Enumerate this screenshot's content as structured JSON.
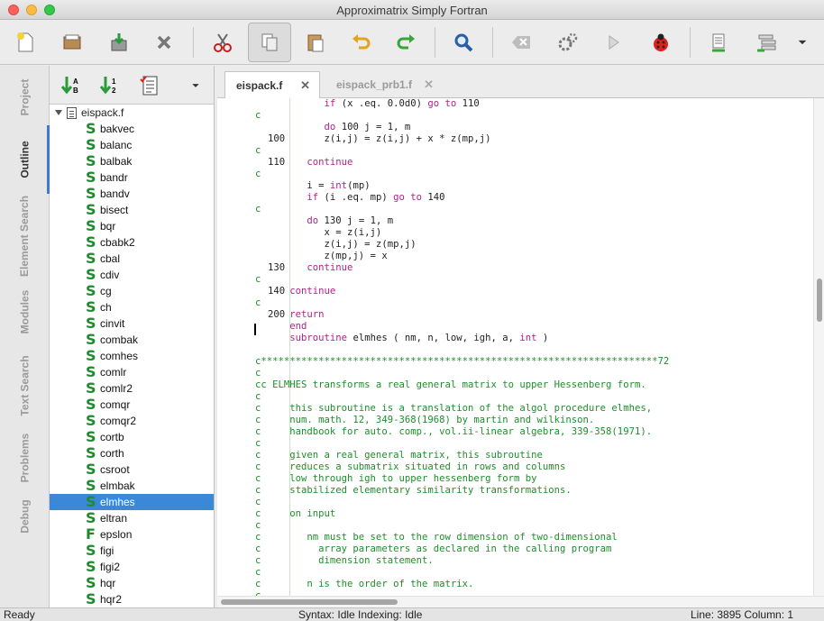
{
  "window": {
    "title": "Approximatrix Simply Fortran"
  },
  "toolbar": {
    "buttons": [
      "new-file",
      "open-folder",
      "save",
      "close",
      "cut",
      "copy",
      "paste",
      "undo",
      "redo",
      "find",
      "clear",
      "build",
      "run",
      "debug",
      "bookmark",
      "project-build",
      "more"
    ]
  },
  "side_tabs": [
    "Project",
    "Outline",
    "Element Search",
    "Modules",
    "Text Search",
    "Problems",
    "Debug"
  ],
  "outline": {
    "root": "eispack.f",
    "items": [
      {
        "kind": "S",
        "name": "bakvec"
      },
      {
        "kind": "S",
        "name": "balanc"
      },
      {
        "kind": "S",
        "name": "balbak"
      },
      {
        "kind": "S",
        "name": "bandr"
      },
      {
        "kind": "S",
        "name": "bandv"
      },
      {
        "kind": "S",
        "name": "bisect"
      },
      {
        "kind": "S",
        "name": "bqr"
      },
      {
        "kind": "S",
        "name": "cbabk2"
      },
      {
        "kind": "S",
        "name": "cbal"
      },
      {
        "kind": "S",
        "name": "cdiv"
      },
      {
        "kind": "S",
        "name": "cg"
      },
      {
        "kind": "S",
        "name": "ch"
      },
      {
        "kind": "S",
        "name": "cinvit"
      },
      {
        "kind": "S",
        "name": "combak"
      },
      {
        "kind": "S",
        "name": "comhes"
      },
      {
        "kind": "S",
        "name": "comlr"
      },
      {
        "kind": "S",
        "name": "comlr2"
      },
      {
        "kind": "S",
        "name": "comqr"
      },
      {
        "kind": "S",
        "name": "comqr2"
      },
      {
        "kind": "S",
        "name": "cortb"
      },
      {
        "kind": "S",
        "name": "corth"
      },
      {
        "kind": "S",
        "name": "csroot"
      },
      {
        "kind": "S",
        "name": "elmbak"
      },
      {
        "kind": "S",
        "name": "elmhes",
        "selected": true
      },
      {
        "kind": "S",
        "name": "eltran"
      },
      {
        "kind": "F",
        "name": "epslon"
      },
      {
        "kind": "S",
        "name": "figi"
      },
      {
        "kind": "S",
        "name": "figi2"
      },
      {
        "kind": "S",
        "name": "hqr"
      },
      {
        "kind": "S",
        "name": "hqr2"
      }
    ]
  },
  "editor": {
    "tabs": [
      {
        "label": "eispack.f",
        "active": true
      },
      {
        "label": "eispack_prb1.f",
        "active": false
      }
    ],
    "lines": [
      {
        "label": "",
        "segs": [
          [
            "id",
            "            "
          ],
          [
            "kw",
            "if"
          ],
          [
            "id",
            " (x .eq. 0.0d0) "
          ],
          [
            "kw",
            "go to"
          ],
          [
            "id",
            " 110"
          ]
        ]
      },
      {
        "label": "",
        "segs": [
          [
            "cm",
            "c"
          ]
        ]
      },
      {
        "label": "",
        "segs": [
          [
            "id",
            "            "
          ],
          [
            "kw",
            "do"
          ],
          [
            "id",
            " 100 j = 1, m"
          ]
        ]
      },
      {
        "label": "100",
        "segs": [
          [
            "id",
            "            z(i,j) = z(i,j) + x * z(mp,j)"
          ]
        ]
      },
      {
        "label": "",
        "segs": [
          [
            "cm",
            "c"
          ]
        ]
      },
      {
        "label": "110",
        "segs": [
          [
            "id",
            "         "
          ],
          [
            "kw",
            "continue"
          ]
        ]
      },
      {
        "label": "",
        "segs": [
          [
            "cm",
            "c"
          ]
        ]
      },
      {
        "label": "",
        "segs": [
          [
            "id",
            "         i = "
          ],
          [
            "kw",
            "int"
          ],
          [
            "id",
            "(mp)"
          ]
        ]
      },
      {
        "label": "",
        "segs": [
          [
            "id",
            "         "
          ],
          [
            "kw",
            "if"
          ],
          [
            "id",
            " (i .eq. mp) "
          ],
          [
            "kw",
            "go to"
          ],
          [
            "id",
            " 140"
          ]
        ]
      },
      {
        "label": "",
        "segs": [
          [
            "cm",
            "c"
          ]
        ]
      },
      {
        "label": "",
        "segs": [
          [
            "id",
            "         "
          ],
          [
            "kw",
            "do"
          ],
          [
            "id",
            " 130 j = 1, m"
          ]
        ]
      },
      {
        "label": "",
        "segs": [
          [
            "id",
            "            x = z(i,j)"
          ]
        ]
      },
      {
        "label": "",
        "segs": [
          [
            "id",
            "            z(i,j) = z(mp,j)"
          ]
        ]
      },
      {
        "label": "",
        "segs": [
          [
            "id",
            "            z(mp,j) = x"
          ]
        ]
      },
      {
        "label": "130",
        "segs": [
          [
            "id",
            "         "
          ],
          [
            "kw",
            "continue"
          ]
        ]
      },
      {
        "label": "",
        "segs": [
          [
            "cm",
            "c"
          ]
        ]
      },
      {
        "label": "140",
        "segs": [
          [
            "id",
            "      "
          ],
          [
            "kw",
            "continue"
          ]
        ]
      },
      {
        "label": "",
        "segs": [
          [
            "cm",
            "c"
          ]
        ]
      },
      {
        "label": "200",
        "segs": [
          [
            "id",
            "      "
          ],
          [
            "kw",
            "return"
          ]
        ]
      },
      {
        "label": "",
        "segs": [
          [
            "id",
            "      "
          ],
          [
            "kw",
            "end"
          ]
        ]
      },
      {
        "label": "",
        "segs": [
          [
            "id",
            "      "
          ],
          [
            "kw",
            "subroutine"
          ],
          [
            "id",
            " elmhes ( nm, n, low, igh, a, "
          ],
          [
            "kw",
            "int"
          ],
          [
            "id",
            " )"
          ]
        ]
      },
      {
        "label": "",
        "segs": [
          [
            "id",
            ""
          ]
        ]
      },
      {
        "label": "",
        "segs": [
          [
            "cm",
            "c*********************************************************************72"
          ]
        ]
      },
      {
        "label": "",
        "segs": [
          [
            "cm",
            "c"
          ]
        ]
      },
      {
        "label": "",
        "segs": [
          [
            "cm",
            "cc ELMHES transforms a real general matrix to upper Hessenberg form."
          ]
        ]
      },
      {
        "label": "",
        "segs": [
          [
            "cm",
            "c"
          ]
        ]
      },
      {
        "label": "",
        "segs": [
          [
            "cm",
            "c     this subroutine is a translation of the algol procedure elmhes,"
          ]
        ]
      },
      {
        "label": "",
        "segs": [
          [
            "cm",
            "c     num. math. 12, 349-368(1968) by martin and wilkinson."
          ]
        ]
      },
      {
        "label": "",
        "segs": [
          [
            "cm",
            "c     handbook for auto. comp., vol.ii-linear algebra, 339-358(1971)."
          ]
        ]
      },
      {
        "label": "",
        "segs": [
          [
            "cm",
            "c"
          ]
        ]
      },
      {
        "label": "",
        "segs": [
          [
            "cm",
            "c     given a real general matrix, this subroutine"
          ]
        ]
      },
      {
        "label": "",
        "segs": [
          [
            "cm",
            "c     reduces a submatrix situated in rows and columns"
          ]
        ]
      },
      {
        "label": "",
        "segs": [
          [
            "cm",
            "c     low through igh to upper hessenberg form by"
          ]
        ]
      },
      {
        "label": "",
        "segs": [
          [
            "cm",
            "c     stabilized elementary similarity transformations."
          ]
        ]
      },
      {
        "label": "",
        "segs": [
          [
            "cm",
            "c"
          ]
        ]
      },
      {
        "label": "",
        "segs": [
          [
            "cm",
            "c     on input"
          ]
        ]
      },
      {
        "label": "",
        "segs": [
          [
            "cm",
            "c"
          ]
        ]
      },
      {
        "label": "",
        "segs": [
          [
            "cm",
            "c        nm must be set to the row dimension of two-dimensional"
          ]
        ]
      },
      {
        "label": "",
        "segs": [
          [
            "cm",
            "c          array parameters as declared in the calling program"
          ]
        ]
      },
      {
        "label": "",
        "segs": [
          [
            "cm",
            "c          dimension statement."
          ]
        ]
      },
      {
        "label": "",
        "segs": [
          [
            "cm",
            "c"
          ]
        ]
      },
      {
        "label": "",
        "segs": [
          [
            "cm",
            "c        n is the order of the matrix."
          ]
        ]
      },
      {
        "label": "",
        "segs": [
          [
            "cm",
            "c"
          ]
        ]
      }
    ]
  },
  "status": {
    "left": "Ready",
    "middle": "Syntax: Idle  Indexing: Idle",
    "right": "Line: 3895 Column: 1"
  },
  "colors": {
    "selection": "#3b88d8",
    "comment": "#1e8f2a",
    "keyword": "#b0228b",
    "subroutine_icon": "#1f8a2e"
  }
}
